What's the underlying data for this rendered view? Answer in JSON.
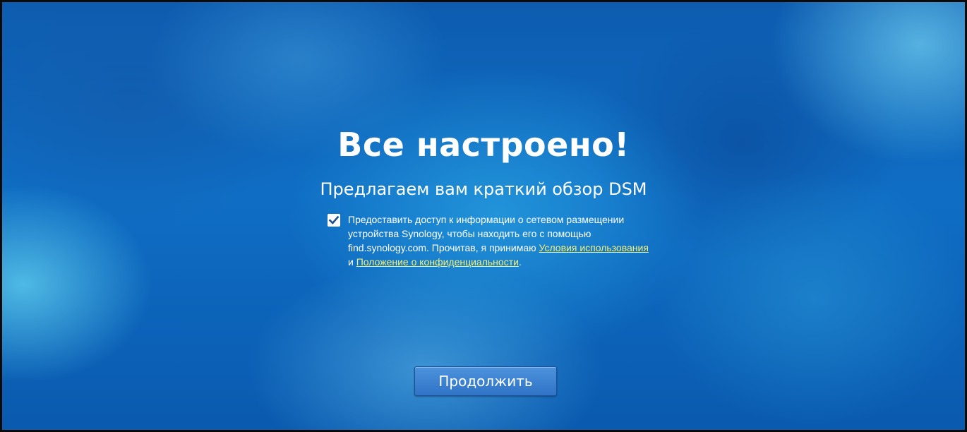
{
  "header": {
    "title": "Все настроено!",
    "subtitle": "Предлагаем вам краткий обзор DSM"
  },
  "consent": {
    "checked": true,
    "text_before": "Предоставить доступ к информации о сетевом размещении устройства Synology, чтобы находить его с помощью find.synology.com. Прочитав, я принимаю ",
    "terms_link": "Условия использования",
    "conjunction": " и ",
    "privacy_link": "Положение о конфиденциальности",
    "text_after": "."
  },
  "actions": {
    "continue_label": "Продолжить"
  },
  "colors": {
    "background": "#0f6ec4",
    "link": "#f2ef7a",
    "button": "#3a7fcf"
  },
  "icons": {
    "checkbox": "checkmark-icon"
  }
}
